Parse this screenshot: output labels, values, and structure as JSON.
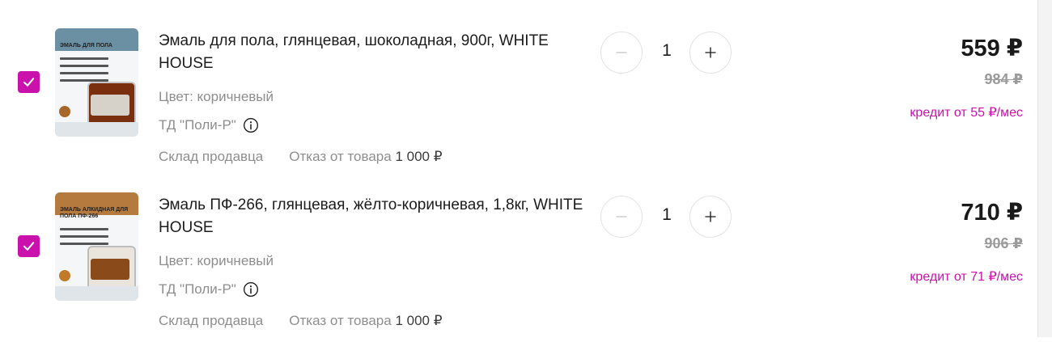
{
  "accent_color": "#cb11ab",
  "items": [
    {
      "title": "Эмаль для пола, глянцевая, шоколадная, 900г, WHITE HOUSE",
      "color": "Цвет: коричневый",
      "seller": "ТД \"Поли-Р\"",
      "warehouse": "Склад продавца",
      "refund_label": "Отказ от товара",
      "refund_value": "1 000 ₽",
      "quantity": "1",
      "price": "559 ₽",
      "old_price": "984 ₽",
      "credit": "кредит от 55 ₽/мес",
      "thumb_title": "ЭМАЛЬ ДЛЯ ПОЛА",
      "checked": true
    },
    {
      "title": "Эмаль ПФ-266, глянцевая, жёлто-коричневая, 1,8кг, WHITE HOUSE",
      "color": "Цвет: коричневый",
      "seller": "ТД \"Поли-Р\"",
      "warehouse": "Склад продавца",
      "refund_label": "Отказ от товара",
      "refund_value": "1 000 ₽",
      "quantity": "1",
      "price": "710 ₽",
      "old_price": "906 ₽",
      "credit": "кредит от 71 ₽/мес",
      "thumb_title": "ЭМАЛЬ АЛКИДНАЯ ДЛЯ ПОЛА ПФ-266",
      "checked": true
    }
  ],
  "icons": {
    "checkbox": "check-icon",
    "info": "info-icon",
    "minus": "minus-icon",
    "plus": "plus-icon"
  }
}
